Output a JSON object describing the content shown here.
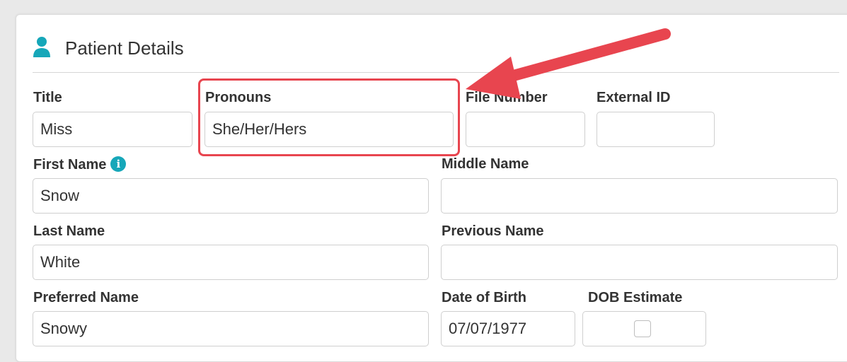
{
  "section": {
    "title": "Patient Details",
    "icon": "person-icon"
  },
  "fields": {
    "title": {
      "label": "Title",
      "value": "Miss"
    },
    "pronouns": {
      "label": "Pronouns",
      "value": "She/Her/Hers"
    },
    "file_number": {
      "label": "File Number",
      "value": ""
    },
    "external_id": {
      "label": "External ID",
      "value": ""
    },
    "first_name": {
      "label": "First Name",
      "value": "Snow",
      "info_icon": "info-icon"
    },
    "middle_name": {
      "label": "Middle Name",
      "value": ""
    },
    "last_name": {
      "label": "Last Name",
      "value": "White"
    },
    "previous_name": {
      "label": "Previous Name",
      "value": ""
    },
    "preferred_name": {
      "label": "Preferred Name",
      "value": "Snowy"
    },
    "dob": {
      "label": "Date of Birth",
      "value": "07/07/1977"
    },
    "dob_estimate": {
      "label": "DOB Estimate",
      "checked": false
    }
  },
  "colors": {
    "accent": "#16a7b9",
    "highlight": "#e8454f",
    "arrow": "#e8454f"
  },
  "annotation": {
    "type": "callout-arrow",
    "target": "pronouns"
  }
}
